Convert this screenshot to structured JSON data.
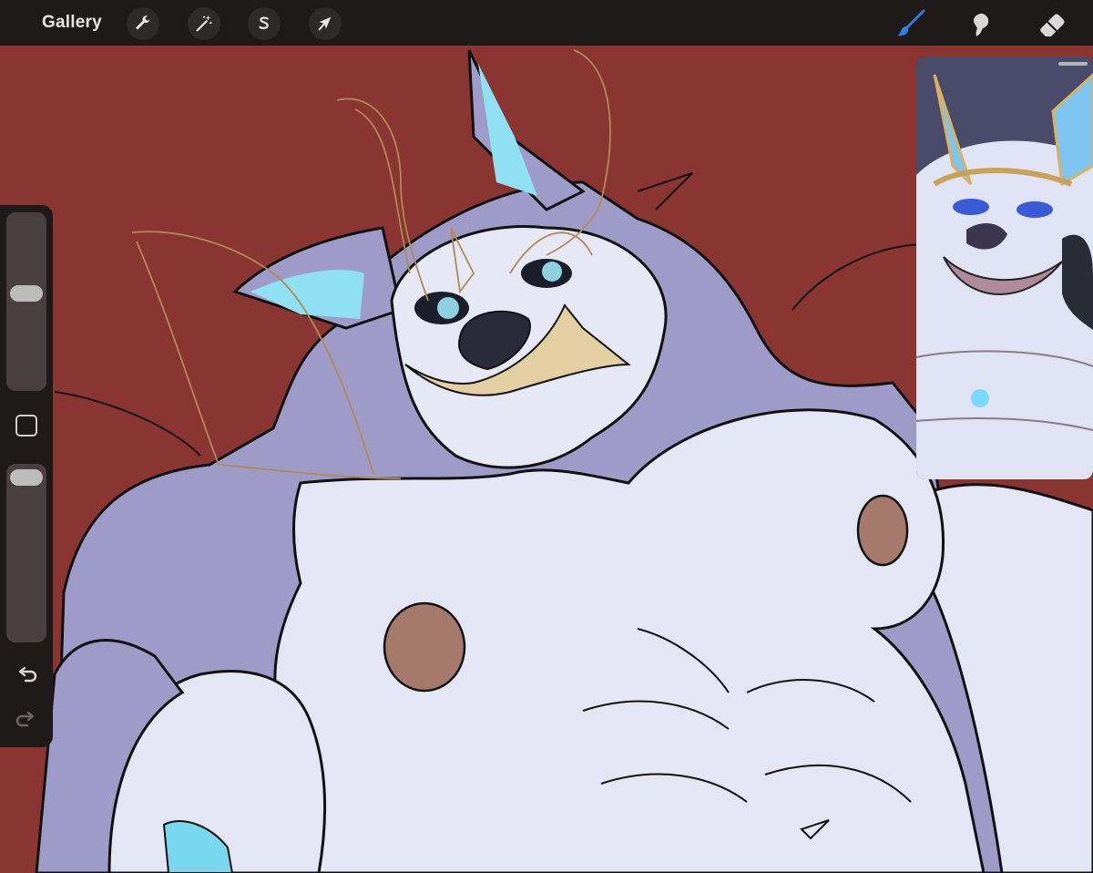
{
  "toolbar": {
    "gallery_label": "Gallery",
    "left_tools": [
      {
        "name": "actions",
        "icon": "wrench-icon"
      },
      {
        "name": "adjustments",
        "icon": "magic-wand-icon"
      },
      {
        "name": "selection",
        "icon": "selection-s-icon"
      },
      {
        "name": "transform",
        "icon": "arrow-cursor-icon"
      }
    ],
    "right_tools": [
      {
        "name": "brush",
        "icon": "brush-icon",
        "active": true
      },
      {
        "name": "smudge",
        "icon": "smudge-icon",
        "active": false
      },
      {
        "name": "eraser",
        "icon": "eraser-icon",
        "active": false
      }
    ],
    "active_color": "#2f7de1"
  },
  "sidebar": {
    "brush_size_level": 0.35,
    "opacity_level": 0.05
  },
  "canvas": {
    "background_color": "#8a3531"
  },
  "reference": {
    "visible": true
  }
}
